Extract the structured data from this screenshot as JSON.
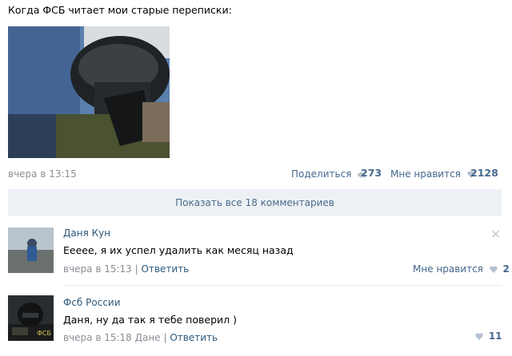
{
  "post": {
    "text": "Когда ФСБ читает мои старые переписки:",
    "time": "вчера в 13:15",
    "share_label": "Поделиться",
    "share_count": "273",
    "like_label": "Мне нравится",
    "like_count": "2128"
  },
  "show_all_comments": "Показать все 18 комментариев",
  "comments": [
    {
      "author": "Даня Кун",
      "text": "Ееeee, я их успел удалить как месяц назад",
      "time": "вчера в 15:13",
      "separator": "|",
      "reply_label": "Ответить",
      "like_label": "Мне нравится",
      "like_count": "2"
    },
    {
      "author": "Фсб России",
      "text": "Даня, ну да так я тебе поверил )",
      "time": "вчера в 15:18",
      "addressee": "Дане",
      "separator": "|",
      "reply_label": "Ответить",
      "like_count": "11"
    }
  ],
  "icons": {
    "share": "megaphone-icon",
    "like": "heart-icon",
    "delete": "close-icon"
  },
  "colors": {
    "link": "#45688e",
    "name": "#2b587a",
    "meta": "#8a8f96",
    "button_bg": "#edf1f5"
  }
}
